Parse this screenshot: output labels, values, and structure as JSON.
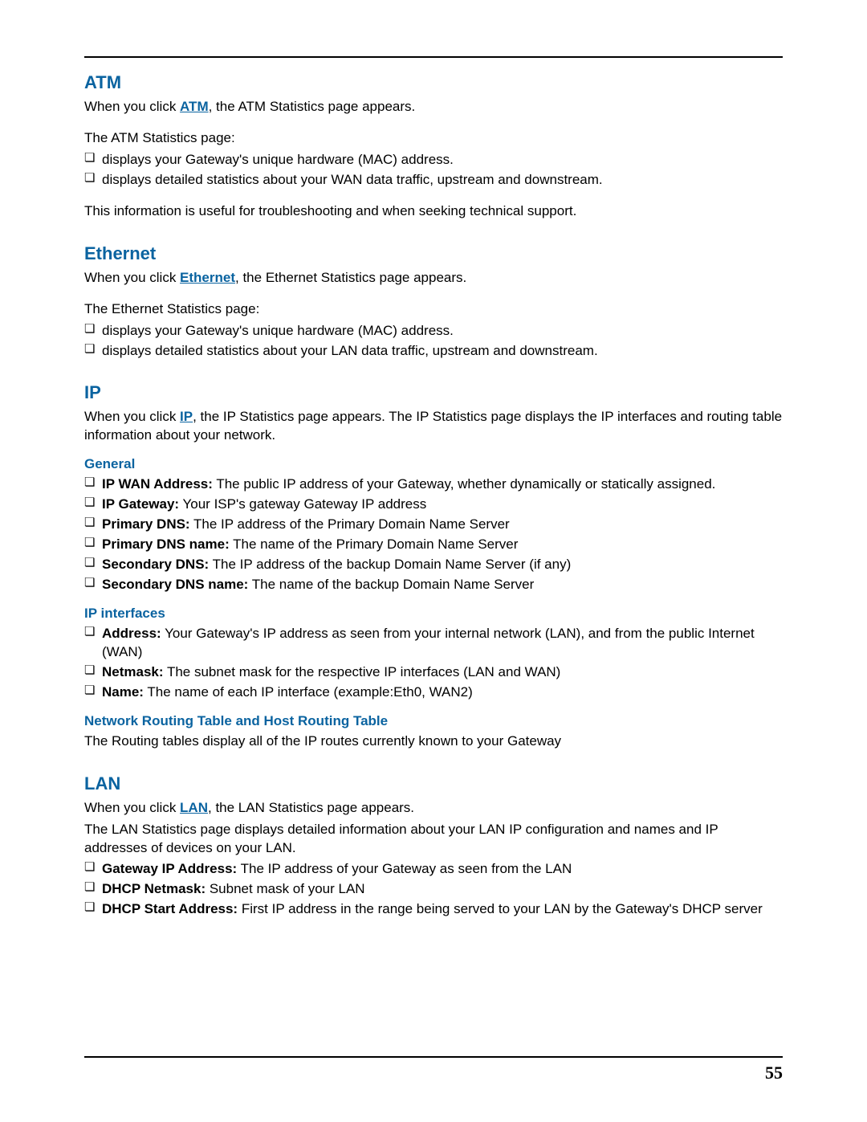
{
  "page_number": "55",
  "atm": {
    "heading": "ATM",
    "intro_pre": "When you click ",
    "intro_link": "ATM",
    "intro_post": ", the ATM Statistics page appears.",
    "lead": "The ATM Statistics page:",
    "bullets": [
      "displays your Gateway's unique hardware (MAC) address.",
      "displays detailed statistics about your WAN data traffic, upstream and downstream."
    ],
    "tail": "This information is useful for troubleshooting and when seeking technical support."
  },
  "ethernet": {
    "heading": "Ethernet",
    "intro_pre": "When you click ",
    "intro_link": "Ethernet",
    "intro_post": ", the Ethernet Statistics page appears.",
    "lead": "The Ethernet Statistics page:",
    "bullets": [
      "displays your Gateway's unique hardware (MAC) address.",
      "displays detailed statistics about your LAN data traffic, upstream and downstream."
    ]
  },
  "ip": {
    "heading": "IP",
    "intro_pre": "When you click ",
    "intro_link": "IP",
    "intro_post": ", the IP Statistics page appears. The IP Statistics page displays the IP interfaces and routing table information about your network.",
    "general": {
      "heading": "General",
      "items": [
        {
          "term": "IP WAN Address:",
          "desc": " The public IP address of your Gateway, whether dynamically or statically assigned."
        },
        {
          "term": "IP Gateway:",
          "desc": " Your ISP's gateway Gateway IP address"
        },
        {
          "term": "Primary DNS:",
          "desc": " The IP address of the Primary Domain Name Server"
        },
        {
          "term": "Primary DNS name:",
          "desc": " The name of the Primary Domain Name Server"
        },
        {
          "term": "Secondary DNS:",
          "desc": " The IP address of the backup Domain Name Server (if any)"
        },
        {
          "term": "Secondary DNS name:",
          "desc": " The name of the backup Domain Name Server"
        }
      ]
    },
    "ipif": {
      "heading": "IP interfaces",
      "items": [
        {
          "term": "Address:",
          "desc": " Your Gateway's IP address as seen from your internal network (LAN), and from the public Internet (WAN)"
        },
        {
          "term": "Netmask:",
          "desc": " The subnet mask for the respective IP interfaces (LAN and WAN)"
        },
        {
          "term": "Name:",
          "desc": " The name of each IP interface (example:Eth0, WAN2)"
        }
      ]
    },
    "routing": {
      "heading": "Network Routing Table and Host Routing Table",
      "body": "The Routing tables display all of the IP routes currently known to your Gateway"
    }
  },
  "lan": {
    "heading": "LAN",
    "intro_pre": "When you click ",
    "intro_link": "LAN",
    "intro_post": ", the LAN Statistics page appears.",
    "body": "The LAN Statistics page displays detailed information about your LAN IP configuration and names and IP addresses of devices on your LAN.",
    "items": [
      {
        "term": "Gateway IP Address:",
        "desc": " The IP address of your Gateway as seen from the LAN"
      },
      {
        "term": "DHCP Netmask:",
        "desc": " Subnet mask of your LAN"
      },
      {
        "term": "DHCP Start Address:",
        "desc": " First IP address in the range being served to your LAN by the Gateway's DHCP server"
      }
    ]
  }
}
